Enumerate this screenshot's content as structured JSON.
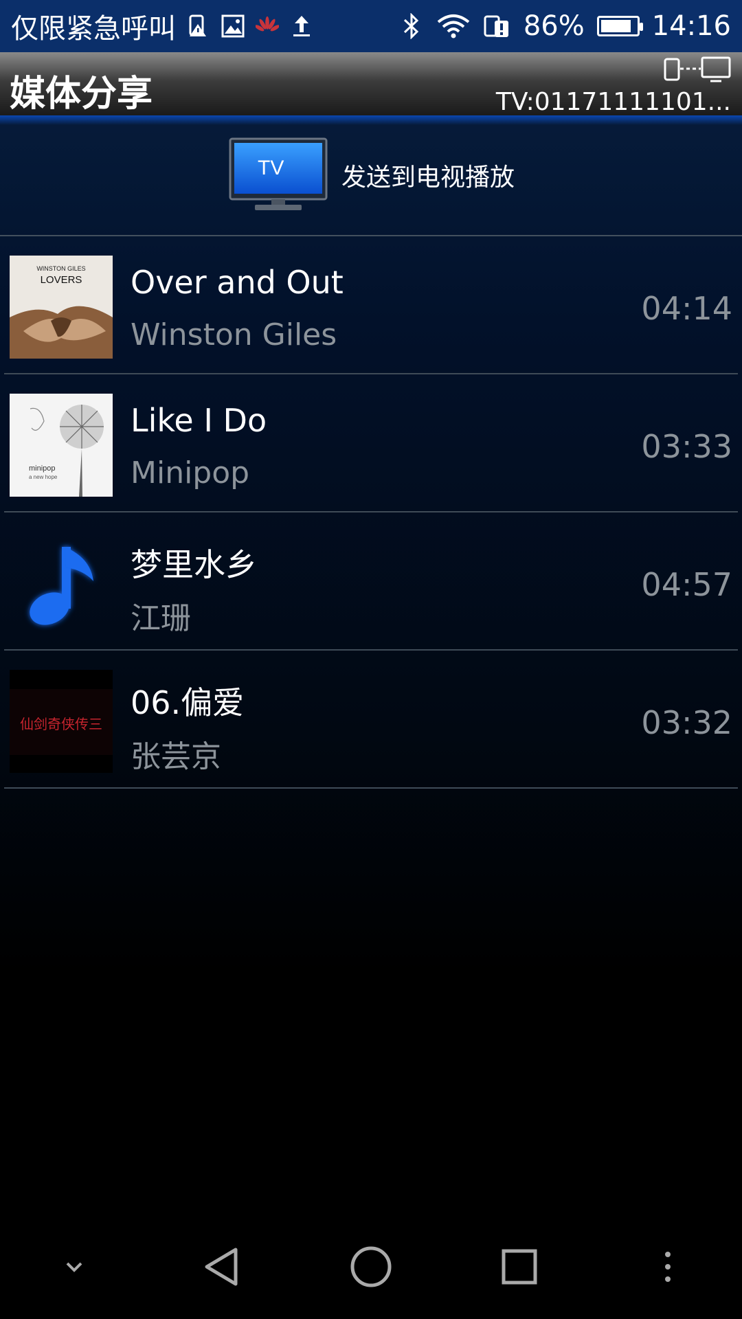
{
  "status_bar": {
    "carrier_text": "仅限紧急呼叫",
    "battery_percent": "86%",
    "battery_level": 0.86,
    "time": "14:16",
    "icons_left": [
      "sim-alert-icon",
      "gallery-icon",
      "huawei-icon",
      "upload-icon"
    ],
    "icons_right": [
      "bluetooth-icon",
      "wifi-icon",
      "dual-sim-icon",
      "battery-icon"
    ]
  },
  "app_bar": {
    "title": "媒体分享",
    "device_id": "TV:01171111101..."
  },
  "send_to_tv": {
    "label": "发送到电视播放",
    "icon_text": "TV"
  },
  "songs": [
    {
      "title": "Over and Out",
      "artist": "Winston Giles",
      "duration": "04:14",
      "art_text_1": "WINSTON GILES",
      "art_text_2": "LOVERS"
    },
    {
      "title": "Like I Do",
      "artist": "Minipop",
      "duration": "03:33",
      "art_text_1": "minipop",
      "art_text_2": "a new hope"
    },
    {
      "title": "梦里水乡",
      "artist": "江珊",
      "duration": "04:57",
      "art": "music-note-icon"
    },
    {
      "title": "06.偏爱",
      "artist": "张芸京",
      "duration": "03:32",
      "art_text_1": "仙剑奇侠传三"
    }
  ],
  "nav_bar": {
    "buttons": [
      "collapse-icon",
      "back-icon",
      "home-icon",
      "recents-icon",
      "more-icon"
    ]
  },
  "colors": {
    "status_bar_bg": "#0b2f6a",
    "secondary_text": "#8d949b",
    "accent_blue": "#1a6cf0"
  }
}
